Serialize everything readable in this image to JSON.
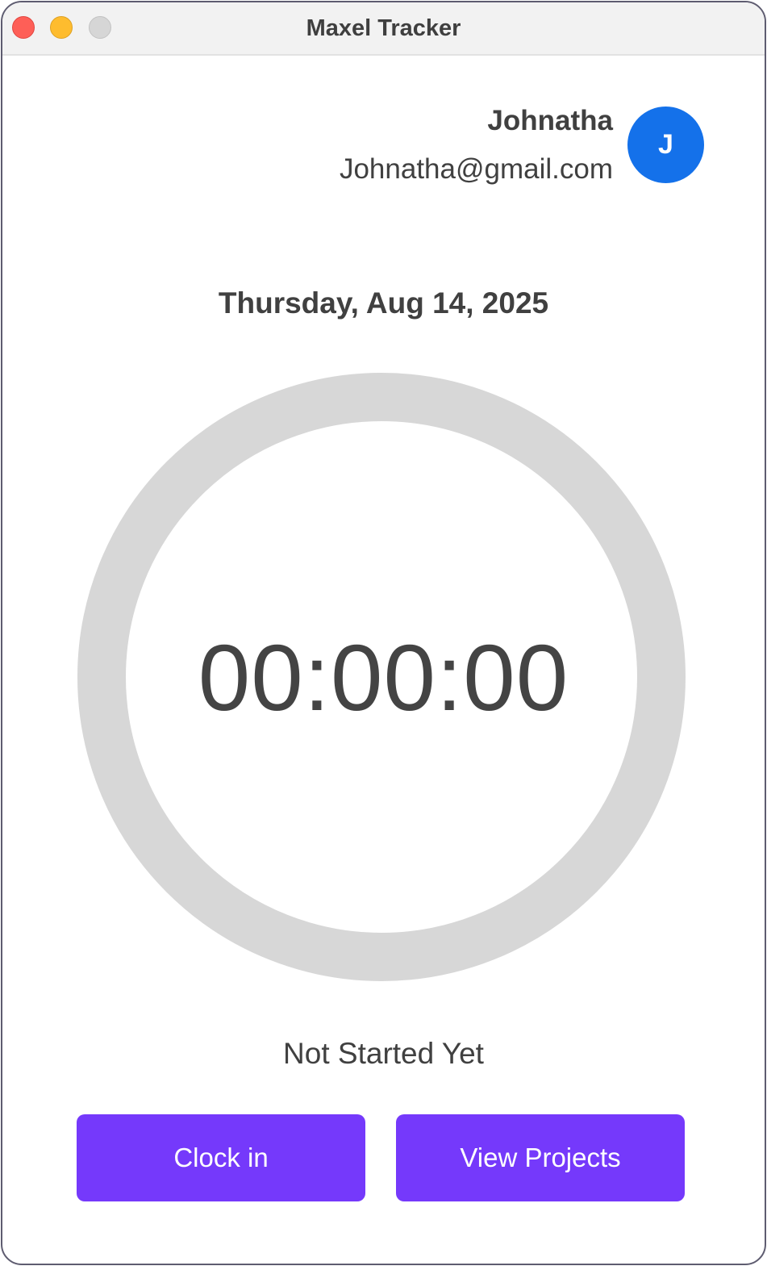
{
  "window": {
    "title": "Maxel Tracker",
    "controls": [
      "close",
      "minimize",
      "zoom"
    ]
  },
  "user": {
    "name": "Johnatha",
    "email": "Johnatha@gmail.com",
    "avatar_initial": "J",
    "avatar_color": "#1471ea"
  },
  "date": "Thursday, Aug 14, 2025",
  "timer": {
    "display": "00:00:00",
    "progress": 0
  },
  "status": "Not Started Yet",
  "actions": {
    "clock_in_label": "Clock in",
    "view_projects_label": "View Projects",
    "button_color": "#7539fb"
  }
}
